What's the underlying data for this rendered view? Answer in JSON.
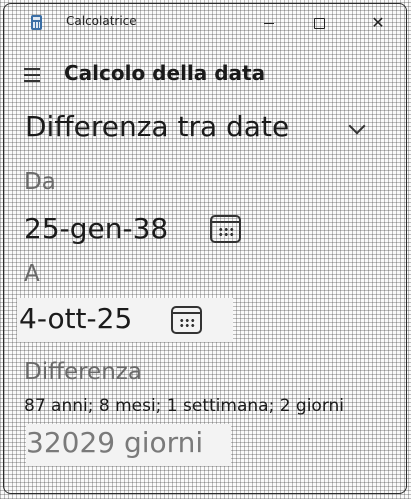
{
  "window": {
    "title": "Calcolatrice",
    "icon": "calculator-icon",
    "controls": {
      "minimize": "minimize-icon",
      "maximize": "maximize-icon",
      "close": "✕"
    }
  },
  "header": {
    "menu_icon": "hamburger-icon",
    "title": "Calcolo della data"
  },
  "mode": {
    "selected": "Differenza tra date",
    "icon": "chevron-down-icon"
  },
  "from": {
    "label": "Da",
    "value": "25-gen-38",
    "icon": "calendar-icon"
  },
  "to": {
    "label": "A",
    "value": "4-ott-25",
    "icon": "calendar-icon"
  },
  "result": {
    "label": "Differenza",
    "detail": "87 anni; 8 mesi; 1 settimana; 2 giorni",
    "days": "32029 giorni"
  }
}
